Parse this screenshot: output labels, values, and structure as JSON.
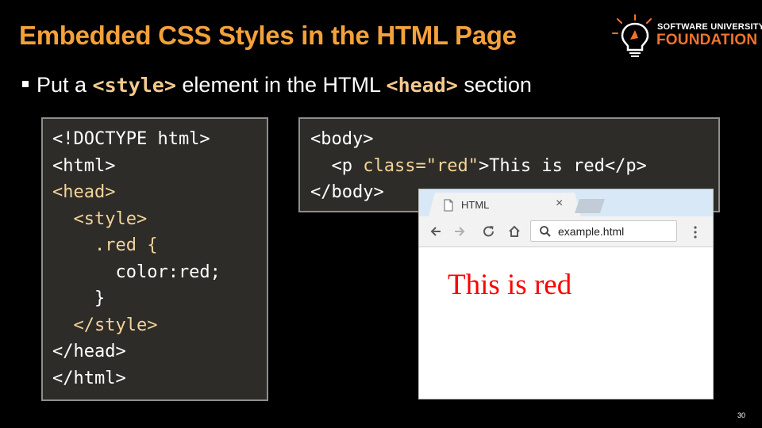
{
  "slide": {
    "title": "Embedded CSS Styles in the HTML Page",
    "bullet": {
      "before": "Put a ",
      "code1": "<style>",
      "middle": " element in the HTML ",
      "code2": "<head>",
      "after": " section"
    },
    "page_number": "30"
  },
  "logo": {
    "line1": "SOFTWARE UNIVERSITY",
    "line2": "FOUNDATION"
  },
  "code_left": {
    "lines": [
      "<!DOCTYPE html>",
      "<html>",
      "<head>",
      "  <style>",
      "    .red {",
      "      color:red;",
      "    }",
      "  </style>",
      "</head>",
      "</html>"
    ]
  },
  "code_right": {
    "line1": "<body>",
    "line2_indent": "  <p ",
    "line2_attr": "class=\"red\"",
    "line2_rest": ">This is red</p>",
    "line3": "</body>"
  },
  "browser": {
    "tab_title": "HTML",
    "tab_close": "×",
    "address": "example.html",
    "page_text": "This is red"
  },
  "colors": {
    "title": "#f3a13a",
    "code_highlight": "#f4d39a",
    "red_text": "#ff0000",
    "logo_accent": "#f0742b"
  }
}
